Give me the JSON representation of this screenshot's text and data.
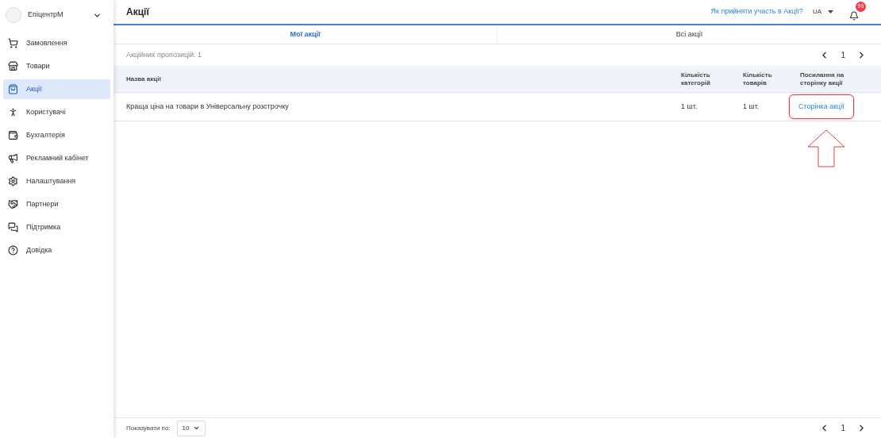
{
  "account": {
    "name": "ЕпіцентрМ"
  },
  "sidebar": {
    "items": [
      {
        "label": "Замовлення",
        "selected": false
      },
      {
        "label": "Товари",
        "selected": false
      },
      {
        "label": "Акції",
        "selected": true
      },
      {
        "label": "Користувачі",
        "selected": false
      },
      {
        "label": "Бухгалтерія",
        "selected": false
      },
      {
        "label": "Рекламний кабінет",
        "selected": false
      },
      {
        "label": "Налаштування",
        "selected": false
      },
      {
        "label": "Партнери",
        "selected": false
      },
      {
        "label": "Підтримка",
        "selected": false
      },
      {
        "label": "Довідка",
        "selected": false
      }
    ]
  },
  "header": {
    "title": "Акції",
    "help_link": "Як прийняти участь в Акції?",
    "language": "UA",
    "notifications": "99"
  },
  "tabs": [
    {
      "label": "Мої акції",
      "selected": true
    },
    {
      "label": "Всі акції",
      "selected": false
    }
  ],
  "summary": "Акційних пропозицій: 1",
  "pagination_top": {
    "page": "1"
  },
  "table": {
    "columns": [
      "Назва акції",
      "Кількість категорій",
      "Кількість товарів",
      "Посилання на сторінку акції"
    ],
    "rows": [
      {
        "name": "Краща ціна на товари в Універсальну розстрочку",
        "categories": "1 шт.",
        "products": "1 шт.",
        "link": "Сторінка акції",
        "annotated": true
      }
    ]
  },
  "footer": {
    "per_page_label": "Показувати по:",
    "per_page_choice": "10",
    "page": "1"
  }
}
